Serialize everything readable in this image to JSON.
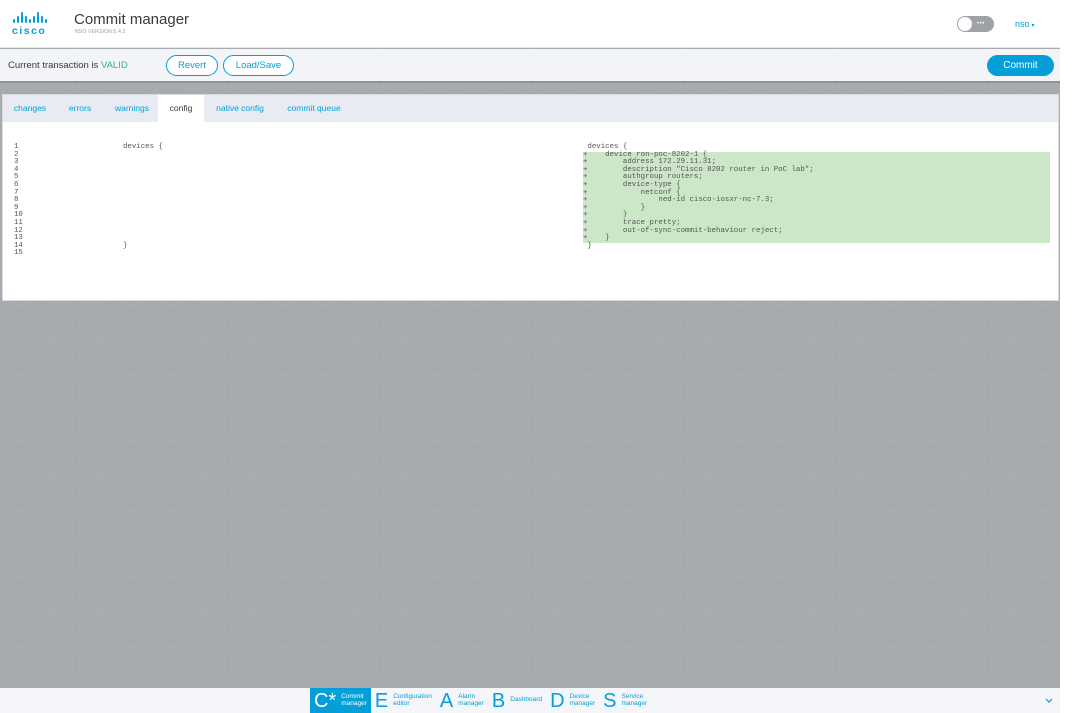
{
  "header": {
    "logo_text": "cisco",
    "title": "Commit manager",
    "version": "NSO VERSION:5.4.2",
    "toggle_label": "•••",
    "user": "nso",
    "user_caret": "▾"
  },
  "transaction": {
    "status_prefix": "Current transaction is ",
    "status_value": "VALID",
    "status_color": "#2bb39a",
    "revert_label": "Revert",
    "load_save_label": "Load/Save",
    "commit_label": "Commit"
  },
  "tabs": [
    {
      "label": "changes",
      "active": false
    },
    {
      "label": "errors",
      "active": false
    },
    {
      "label": "warnings",
      "active": false
    },
    {
      "label": "config",
      "active": true
    },
    {
      "label": "native config",
      "active": false
    },
    {
      "label": "commit queue",
      "active": false
    }
  ],
  "diff": {
    "line_numbers": [
      "1",
      "2",
      "3",
      "4",
      "5",
      "6",
      "7",
      "8",
      "9",
      "10",
      "11",
      "12",
      "13",
      "14",
      "15"
    ],
    "left_lines": [
      "devices {",
      "",
      "",
      "",
      "",
      "",
      "",
      "",
      "",
      "",
      "",
      "",
      "",
      "}",
      ""
    ],
    "right_lines": [
      {
        "text": " devices {",
        "added": false
      },
      {
        "text": "+    device ron-poc-8202-1 {",
        "added": true
      },
      {
        "text": "+        address 172.29.11.31;",
        "added": true
      },
      {
        "text": "+        description \"Cisco 8202 router in PoC lab\";",
        "added": true
      },
      {
        "text": "+        authgroup routers;",
        "added": true
      },
      {
        "text": "+        device-type {",
        "added": true
      },
      {
        "text": "+            netconf {",
        "added": true
      },
      {
        "text": "+                ned-id cisco-iosxr-nc-7.3;",
        "added": true
      },
      {
        "text": "+            }",
        "added": true
      },
      {
        "text": "+        }",
        "added": true
      },
      {
        "text": "+        trace pretty;",
        "added": true
      },
      {
        "text": "+        out-of-sync-commit-behaviour reject;",
        "added": true
      },
      {
        "text": "+    }",
        "added": true
      },
      {
        "text": " }",
        "added": false
      }
    ],
    "added_color": "#cce6c8"
  },
  "bottom_nav": {
    "items": [
      {
        "letter": "C*",
        "line1": "Commit",
        "line2": "manager",
        "active": true
      },
      {
        "letter": "E",
        "line1": "Configuration",
        "line2": "editor",
        "active": false
      },
      {
        "letter": "A",
        "line1": "Alarm",
        "line2": "manager",
        "active": false
      },
      {
        "letter": "B",
        "line1": "Dashboard",
        "line2": "",
        "active": false
      },
      {
        "letter": "D",
        "line1": "Device",
        "line2": "manager",
        "active": false
      },
      {
        "letter": "S",
        "line1": "Service",
        "line2": "manager",
        "active": false
      }
    ],
    "expand_icon": "chevron-down",
    "accent": "#049fd9"
  },
  "figure_id": "521939"
}
